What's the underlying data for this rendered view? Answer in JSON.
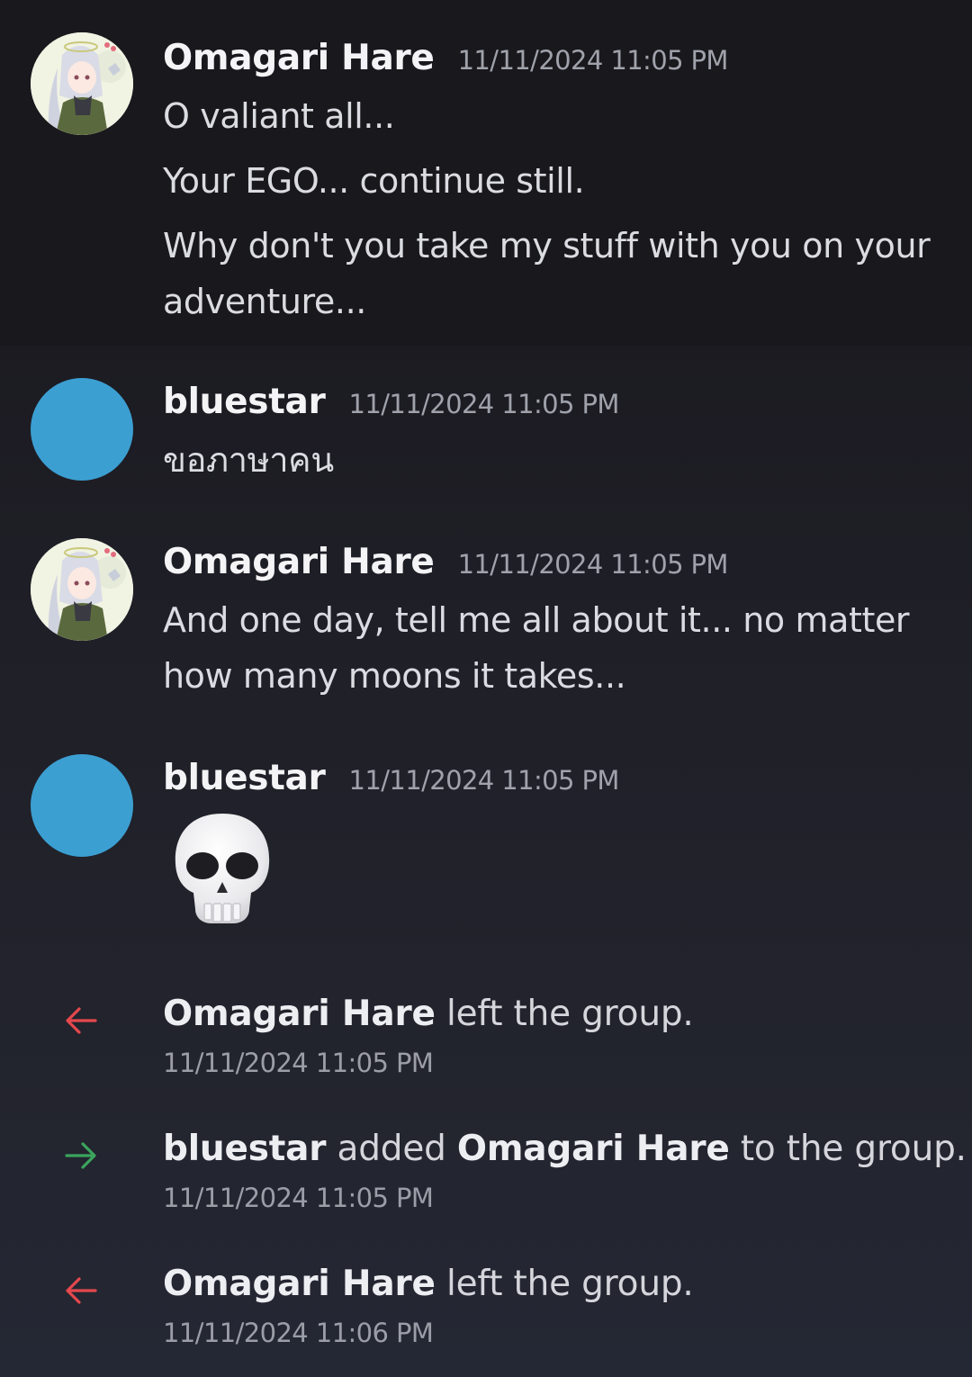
{
  "messages": [
    {
      "author": "Omagari Hare",
      "time": "11/11/2024 11:05 PM",
      "lines": [
        "O valiant all...",
        "Your EGO... continue still.",
        "Why don't you take my stuff with you on your",
        "adventure..."
      ]
    },
    {
      "author": "bluestar",
      "time": "11/11/2024 11:05 PM",
      "lines": [
        "ขอภาษาคน"
      ]
    },
    {
      "author": "Omagari Hare",
      "time": "11/11/2024 11:05 PM",
      "lines": [
        "And one day, tell me all about it... no matter",
        "how many moons it takes..."
      ]
    },
    {
      "author": "bluestar",
      "time": "11/11/2024 11:05 PM",
      "emoji": "skull-emoji"
    }
  ],
  "system_events": [
    {
      "type": "leave",
      "actor": "Omagari Hare",
      "text": " left the group.",
      "time": "11/11/2024 11:05 PM",
      "arrow_color": "#e5484d"
    },
    {
      "type": "add",
      "actor": "bluestar",
      "middle": " added ",
      "target": "Omagari Hare",
      "text": " to the group.",
      "time": "11/11/2024 11:05 PM",
      "arrow_color": "#3ba55d"
    },
    {
      "type": "leave",
      "actor": "Omagari Hare",
      "text": " left the group.",
      "time": "11/11/2024 11:06 PM",
      "arrow_color": "#e5484d"
    }
  ],
  "colors": {
    "background": "#1f1f27",
    "avatar_blue": "#3c9fd2",
    "leave_arrow": "#e5484d",
    "join_arrow": "#3ba55d"
  }
}
